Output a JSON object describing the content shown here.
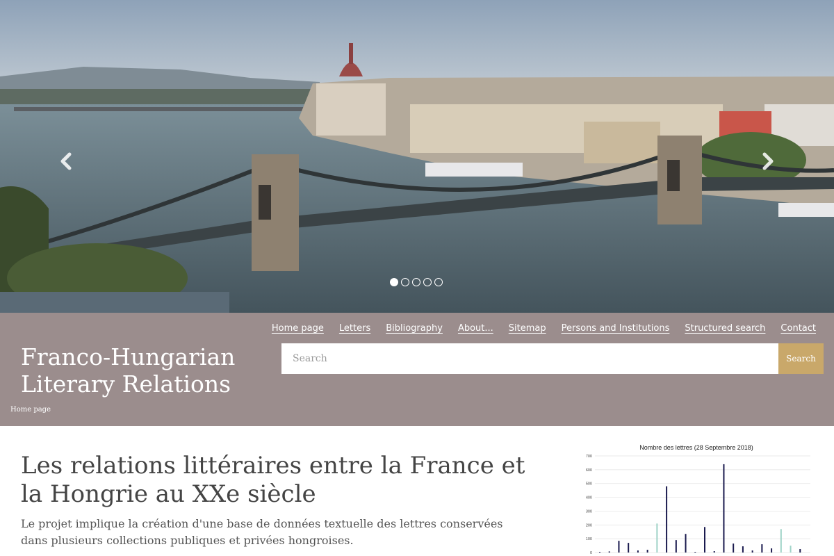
{
  "carousel": {
    "prev_label": "Previous",
    "next_label": "Next",
    "slide_count": 5,
    "active_slide": 1
  },
  "nav": {
    "items": [
      {
        "label": "Home page"
      },
      {
        "label": "Letters"
      },
      {
        "label": "Bibliography"
      },
      {
        "label": "About..."
      },
      {
        "label": "Sitemap"
      },
      {
        "label": "Persons and Institutions"
      },
      {
        "label": "Structured search"
      },
      {
        "label": "Contact"
      }
    ]
  },
  "site": {
    "title_line1": "Franco-Hungarian",
    "title_line2": "Literary Relations"
  },
  "search": {
    "placeholder": "Search",
    "button_label": "Search"
  },
  "breadcrumb": {
    "current": "Home page"
  },
  "main": {
    "heading": "Les relations littéraires entre la France et la Hongrie au XXe siècle",
    "intro": "Le projet implique la création d'une base de données textuelle des lettres conservées dans plusieurs collections publiques et privées hongroises."
  },
  "colors": {
    "band": "#9b8d8d",
    "search_button": "#c9a86a",
    "bar_dark": "#1a1a4e",
    "bar_light": "#9fd3c7"
  },
  "chart_data": {
    "type": "bar",
    "title": "Nombre des lettres (28 Septembre 2018)",
    "ylim": [
      0,
      700
    ],
    "yticks": [
      "0",
      "100",
      "200",
      "300",
      "400",
      "500",
      "600",
      "700"
    ],
    "grid": true,
    "values": [
      5,
      8,
      85,
      70,
      15,
      20,
      210,
      480,
      90,
      135,
      5,
      185,
      10,
      640,
      65,
      45,
      15,
      60,
      30,
      170,
      50,
      25
    ],
    "highlight": [
      false,
      false,
      false,
      false,
      false,
      false,
      true,
      false,
      false,
      false,
      false,
      false,
      false,
      false,
      false,
      false,
      false,
      false,
      false,
      true,
      true,
      false
    ]
  }
}
